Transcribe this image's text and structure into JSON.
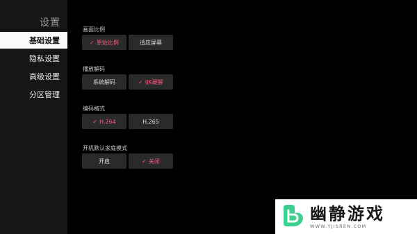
{
  "sidebar": {
    "title": "设置",
    "items": [
      {
        "label": "基础设置",
        "active": true
      },
      {
        "label": "隐私设置",
        "active": false
      },
      {
        "label": "高级设置",
        "active": false
      },
      {
        "label": "分区管理",
        "active": false
      }
    ]
  },
  "sections": [
    {
      "title": "画面比例",
      "options": [
        {
          "label": "原始比例",
          "selected": true
        },
        {
          "label": "适应屏幕",
          "selected": false
        }
      ]
    },
    {
      "title": "播放解码",
      "options": [
        {
          "label": "系统解码",
          "selected": false
        },
        {
          "label": "IJK硬解",
          "selected": true
        }
      ]
    },
    {
      "title": "编码格式",
      "options": [
        {
          "label": "H.264",
          "selected": true
        },
        {
          "label": "H.265",
          "selected": false
        }
      ]
    },
    {
      "title": "开机默认家庭模式",
      "options": [
        {
          "label": "开启",
          "selected": false
        },
        {
          "label": "关闭",
          "selected": true
        }
      ]
    }
  ],
  "icons": {
    "check": "check-icon"
  },
  "colors": {
    "accent": "#ff5a82",
    "sidebar_bg": "#161616",
    "button_bg": "#2a2a2a"
  },
  "watermark": {
    "name": "幽静游戏",
    "url": "WWW.YJISREN.COM",
    "logo_color": "#3ccf8e"
  }
}
